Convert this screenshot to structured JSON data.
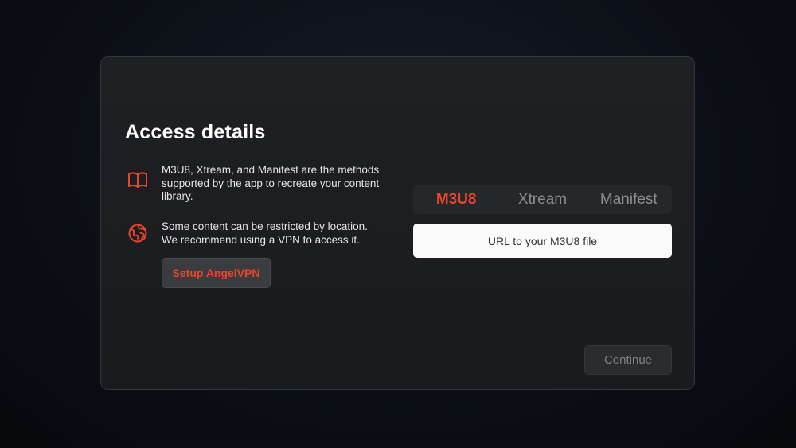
{
  "dialog": {
    "title": "Access details",
    "info": [
      {
        "icon": "book-icon",
        "text": "M3U8, Xtream, and Manifest are the methods supported by the app to recreate your content library."
      },
      {
        "icon": "globe-icon",
        "text": "Some content can be restricted by location. We recommend using a VPN to access it."
      }
    ],
    "vpn_button_label": "Setup AngelVPN",
    "tabs": [
      {
        "label": "M3U8",
        "active": true
      },
      {
        "label": "Xtream",
        "active": false
      },
      {
        "label": "Manifest",
        "active": false
      }
    ],
    "url_input": {
      "value": "",
      "placeholder": "URL to your M3U8 file"
    },
    "continue_label": "Continue"
  },
  "colors": {
    "accent": "#e8452c",
    "panel_bg": "#1c1d20",
    "tab_inactive": "#8b8d92",
    "input_bg": "#fafafa"
  }
}
